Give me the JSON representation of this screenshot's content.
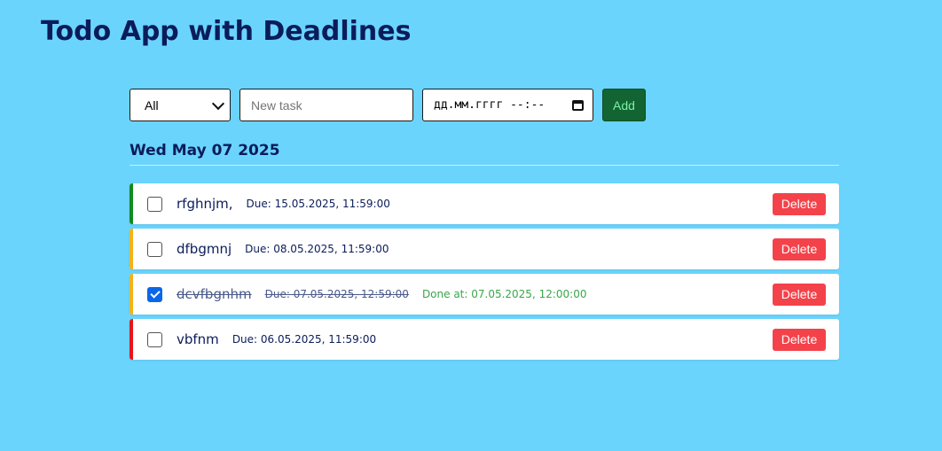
{
  "app": {
    "title": "Todo App with Deadlines"
  },
  "controls": {
    "filter_value": "All",
    "task_placeholder": "New task",
    "date_placeholder": "дд.мм.гггг --:--",
    "add_label": "Add"
  },
  "day": {
    "label": "Wed May 07 2025"
  },
  "colors": {
    "background": "#6ad4fd",
    "stripe_green": "#128a1e",
    "stripe_orange": "#f3b21a",
    "stripe_red": "#e8141c",
    "delete": "#f4424a",
    "add": "#126432"
  },
  "tasks": [
    {
      "text": "rfghnjm,",
      "due": "Due: 15.05.2025, 11:59:00",
      "done": false,
      "done_at": "",
      "delete_label": "Delete"
    },
    {
      "text": "dfbgmnj",
      "due": "Due: 08.05.2025, 11:59:00",
      "done": false,
      "done_at": "",
      "delete_label": "Delete"
    },
    {
      "text": "dcvfbgnhm",
      "due": "Due: 07.05.2025, 12:59:00",
      "done": true,
      "done_at": "Done at: 07.05.2025, 12:00:00",
      "delete_label": "Delete"
    },
    {
      "text": "vbfnm",
      "due": "Due: 06.05.2025, 11:59:00",
      "done": false,
      "done_at": "",
      "delete_label": "Delete"
    }
  ]
}
